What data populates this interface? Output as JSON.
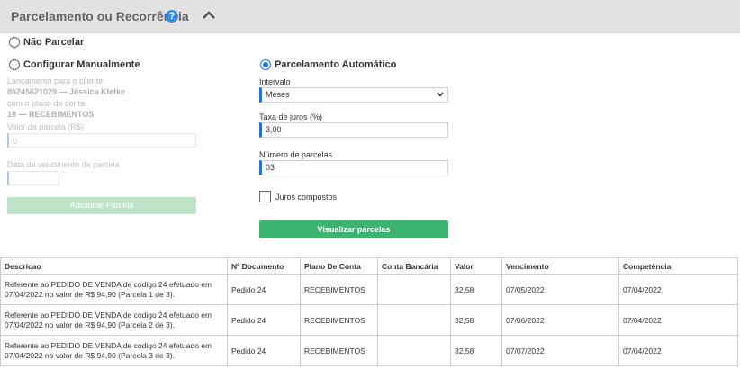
{
  "header": {
    "title": "Parcelamento ou Recorrência",
    "help_icon": "?"
  },
  "options": {
    "nao_parcelar": "Não Parcelar",
    "configurar": "Configurar Manualmente",
    "automatico": "Parcelamento Automático"
  },
  "manual": {
    "line1": "Lançamento para o cliente",
    "line2": "85245621029 — Jéssica Kletke",
    "line3": "com o plano de conta",
    "line4": "10 — RECEBIMENTOS",
    "valor_label": "Valor da parcela (R$)",
    "valor_value": "0",
    "data_label": "Data de vencimento da parcela",
    "button": "Adicionar Parcela"
  },
  "auto": {
    "intervalo_label": "Intervalo",
    "intervalo_value": "Meses",
    "juros_label": "Taxa de juros (%)",
    "juros_value": "3,00",
    "parcelas_label": "Número de parcelas",
    "parcelas_value": "03",
    "compostos_label": "Juros compostos",
    "button": "Visualizar parcelas"
  },
  "table": {
    "headers": [
      "Descricao",
      "Nº Documento",
      "Plano De Conta",
      "Conta Bancária",
      "Valor",
      "Vencimento",
      "Competência"
    ],
    "rows": [
      {
        "desc1": "Referente ao PEDIDO DE VENDA de codigo 24 efetuado em",
        "desc2": "07/04/2022 no valor de R$ 94,90 (Parcela 1 de 3).",
        "doc": "Pedido 24",
        "plano": "RECEBIMENTOS",
        "conta": "",
        "valor": "32,58",
        "venc": "07/05/2022",
        "comp": "07/04/2022"
      },
      {
        "desc1": "Referente ao PEDIDO DE VENDA de codigo 24 efetuado em",
        "desc2": "07/04/2022 no valor de R$ 94,90 (Parcela 2 de 3).",
        "doc": "Pedido 24",
        "plano": "RECEBIMENTOS",
        "conta": "",
        "valor": "32,58",
        "venc": "07/06/2022",
        "comp": "07/04/2022"
      },
      {
        "desc1": "Referente ao PEDIDO DE VENDA de codigo 24 efetuado em",
        "desc2": "07/04/2022 no valor de R$ 94,90 (Parcela 3 de 3).",
        "doc": "Pedido 24",
        "plano": "RECEBIMENTOS",
        "conta": "",
        "valor": "32,58",
        "venc": "07/07/2022",
        "comp": "07/04/2022"
      }
    ]
  },
  "colors": {
    "accent": "#1a73e8",
    "button_green": "#3cb371",
    "header_bg": "#e2e2e2"
  }
}
